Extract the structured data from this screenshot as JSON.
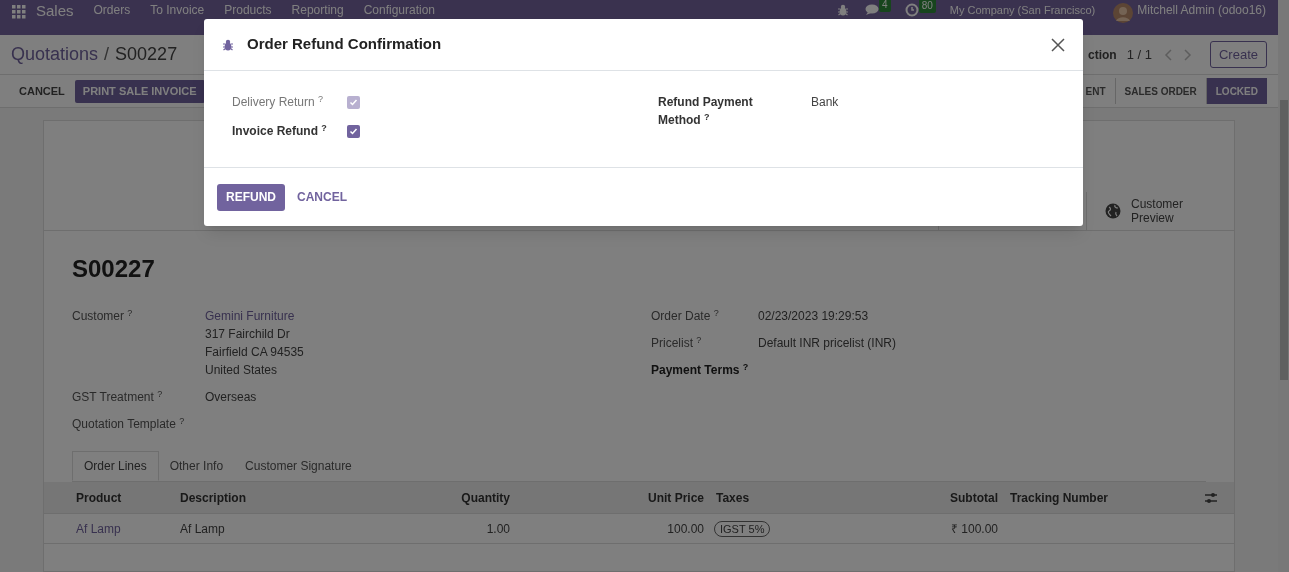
{
  "navbar": {
    "app_name": "Sales",
    "menu": [
      "Orders",
      "To Invoice",
      "Products",
      "Reporting",
      "Configuration"
    ],
    "messages_count": "4",
    "activities_count": "80",
    "company": "My Company (San Francisco)",
    "user": "Mitchell Admin (odoo16)"
  },
  "control_panel": {
    "breadcrumb": [
      "Quotations",
      "S00227"
    ],
    "breadcrumb_separator": "/",
    "action_label": "ction",
    "pager": "1 / 1",
    "create_button": "Create"
  },
  "action_buttons": [
    {
      "label": "CANCEL",
      "primary": false
    },
    {
      "label": "PRINT SALE INVOICE",
      "primary": true
    }
  ],
  "status_steps": [
    {
      "label": "ENT",
      "selected": false
    },
    {
      "label": "SALES ORDER",
      "selected": false
    },
    {
      "label": "LOCKED",
      "selected": true
    }
  ],
  "smart_button": {
    "label": "Customer Preview"
  },
  "order": {
    "name": "S00227",
    "left_fields": [
      {
        "label": "Customer $^{?}$",
        "bold": false,
        "link": true,
        "lines": [
          "Gemini Furniture",
          "317 Fairchild Dr",
          "Fairfield CA 94535",
          "United States"
        ]
      },
      {
        "label": "GST Treatment $^{?}$",
        "bold": false,
        "link": false,
        "lines": [
          "Overseas"
        ]
      },
      {
        "label": "Quotation Template $^{?}$",
        "bold": false
      }
    ],
    "right_fields": [
      {
        "label": "Order Date $^{?}$",
        "bold": false,
        "link": false,
        "lines": [
          "02/23/2023 19:29:53"
        ]
      },
      {
        "label": "Pricelist $^{?}$",
        "bold": false,
        "link": false,
        "lines": [
          "Default INR pricelist (INR)"
        ]
      },
      {
        "label": "Payment Terms $^{?}$",
        "bold": true
      }
    ]
  },
  "tabs": [
    {
      "label": "Order Lines",
      "selected": true
    },
    {
      "label": "Other Info",
      "selected": false
    },
    {
      "label": "Customer Signature",
      "selected": false
    }
  ],
  "table": {
    "columns": [
      {
        "label": "Product",
        "numeric": false
      },
      {
        "label": "Description",
        "numeric": false
      },
      {
        "label": "Quantity",
        "numeric": true
      },
      {
        "label": "Unit Price",
        "numeric": true
      },
      {
        "label": "Taxes",
        "numeric": false
      },
      {
        "label": "Subtotal",
        "numeric": true
      },
      {
        "label": "Tracking Number",
        "numeric": false
      }
    ],
    "rows": [
      {
        "product": "Af Lamp",
        "description": "Af Lamp",
        "quantity": "1.00",
        "unit_price": "100.00",
        "taxes": [
          "IGST 5%"
        ],
        "subtotal": "₹ 100.00"
      }
    ]
  },
  "dialog": {
    "title": "Order Refund Confirmation",
    "options": [
      {
        "label": "Delivery Return $^{?}$",
        "checked": true,
        "disabled": true
      },
      {
        "label": "Invoice Refund $^{?}$",
        "checked": true,
        "disabled": false
      }
    ],
    "payment_method": {
      "label": "Refund Payment Method $^{?}$",
      "value": "Bank"
    },
    "buttons": [
      {
        "label": "REFUND",
        "primary": true
      },
      {
        "label": "CANCEL",
        "primary": false
      }
    ]
  }
}
